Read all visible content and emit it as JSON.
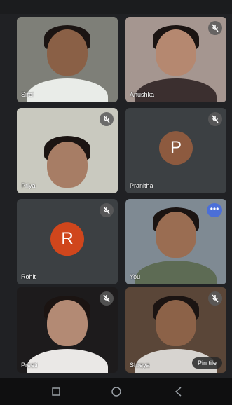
{
  "participants": [
    {
      "name": "Sirei",
      "type": "video",
      "bg": "#7e7f78",
      "muted": false
    },
    {
      "name": "Anushka",
      "type": "video",
      "bg": "#a59690",
      "muted": true
    },
    {
      "name": "Priya",
      "type": "video",
      "bg": "#c9c9bf",
      "muted": true
    },
    {
      "name": "Pranitha",
      "type": "avatar",
      "initial": "P",
      "avatar_color": "#8d5a3f",
      "muted": true
    },
    {
      "name": "Rohit",
      "type": "avatar",
      "initial": "R",
      "avatar_color": "#d0461c",
      "muted": true
    },
    {
      "name": "You",
      "type": "video",
      "bg": "#7f8a93",
      "muted": false,
      "more": true
    },
    {
      "name": "Preeti",
      "type": "video",
      "bg": "#1d1b1c",
      "muted": true
    },
    {
      "name": "Shreya",
      "type": "video",
      "bg": "#5a4638",
      "muted": true,
      "presenting_label": "Pin tile"
    }
  ],
  "more_icon": "•••",
  "navbar": {
    "icons": [
      "back-icon",
      "home-icon",
      "recents-icon"
    ]
  }
}
